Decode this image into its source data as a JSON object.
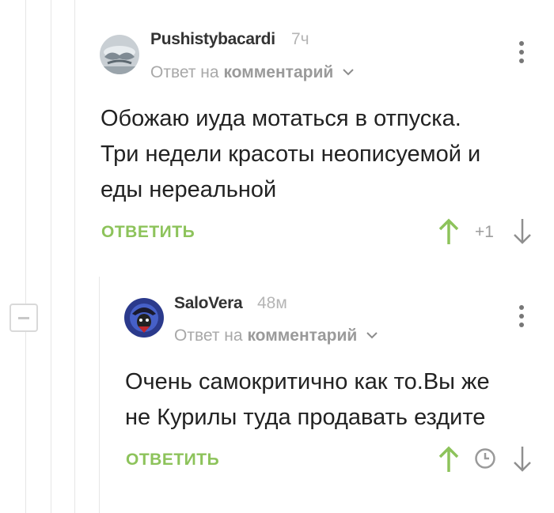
{
  "comments": [
    {
      "username": "Pushistybacardi",
      "time": "7ч",
      "reply_prefix": "Ответ на",
      "reply_link": "комментарий",
      "body": [
        "Обожаю иуда мотаться в отпуска.",
        "Три недели красоты неописуемой и",
        "еды нереальной"
      ],
      "reply_label": "ОТВЕТИТЬ",
      "rating": "+1"
    },
    {
      "username": "SaloVera",
      "time": "48м",
      "reply_prefix": "Ответ на",
      "reply_link": "комментарий",
      "body": [
        "Очень самокритично как то.Вы же",
        "не Курилы туда продавать ездите"
      ],
      "reply_label": "ОТВЕТИТЬ"
    }
  ],
  "colors": {
    "accent_green": "#8dc35b",
    "text": "#222222",
    "muted": "#a8a8a8"
  },
  "icons": [
    "kebab-menu-icon",
    "chevron-down-icon",
    "upvote-arrow-icon",
    "downvote-arrow-icon",
    "clock-icon",
    "collapse-minus-icon"
  ]
}
